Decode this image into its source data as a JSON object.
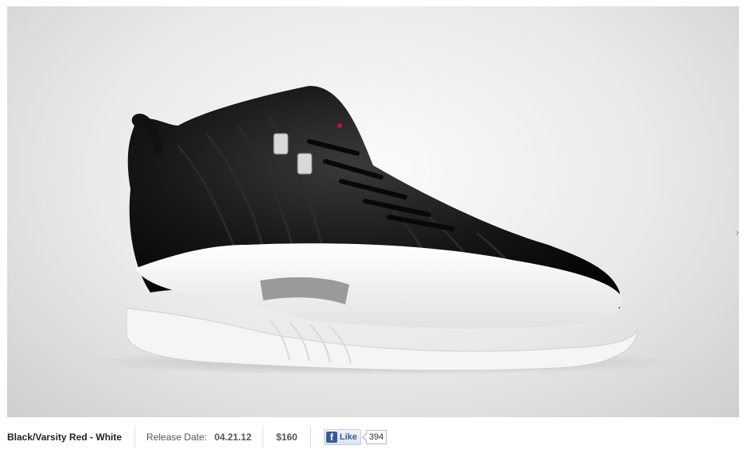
{
  "product": {
    "image_icon": "sneaker-image",
    "colorway": "Black/Varsity Red - White",
    "release_label": "Release Date:",
    "release_date": "04.21.12",
    "price": "$160"
  },
  "facebook": {
    "icon": "facebook-icon",
    "like_label": "Like",
    "count": "394"
  },
  "colors": {
    "facebook_blue": "#3b5998",
    "shoe_black": "#1b1b1b",
    "shoe_white": "#f4f4f4",
    "accent_grey": "#9a9a9a"
  }
}
